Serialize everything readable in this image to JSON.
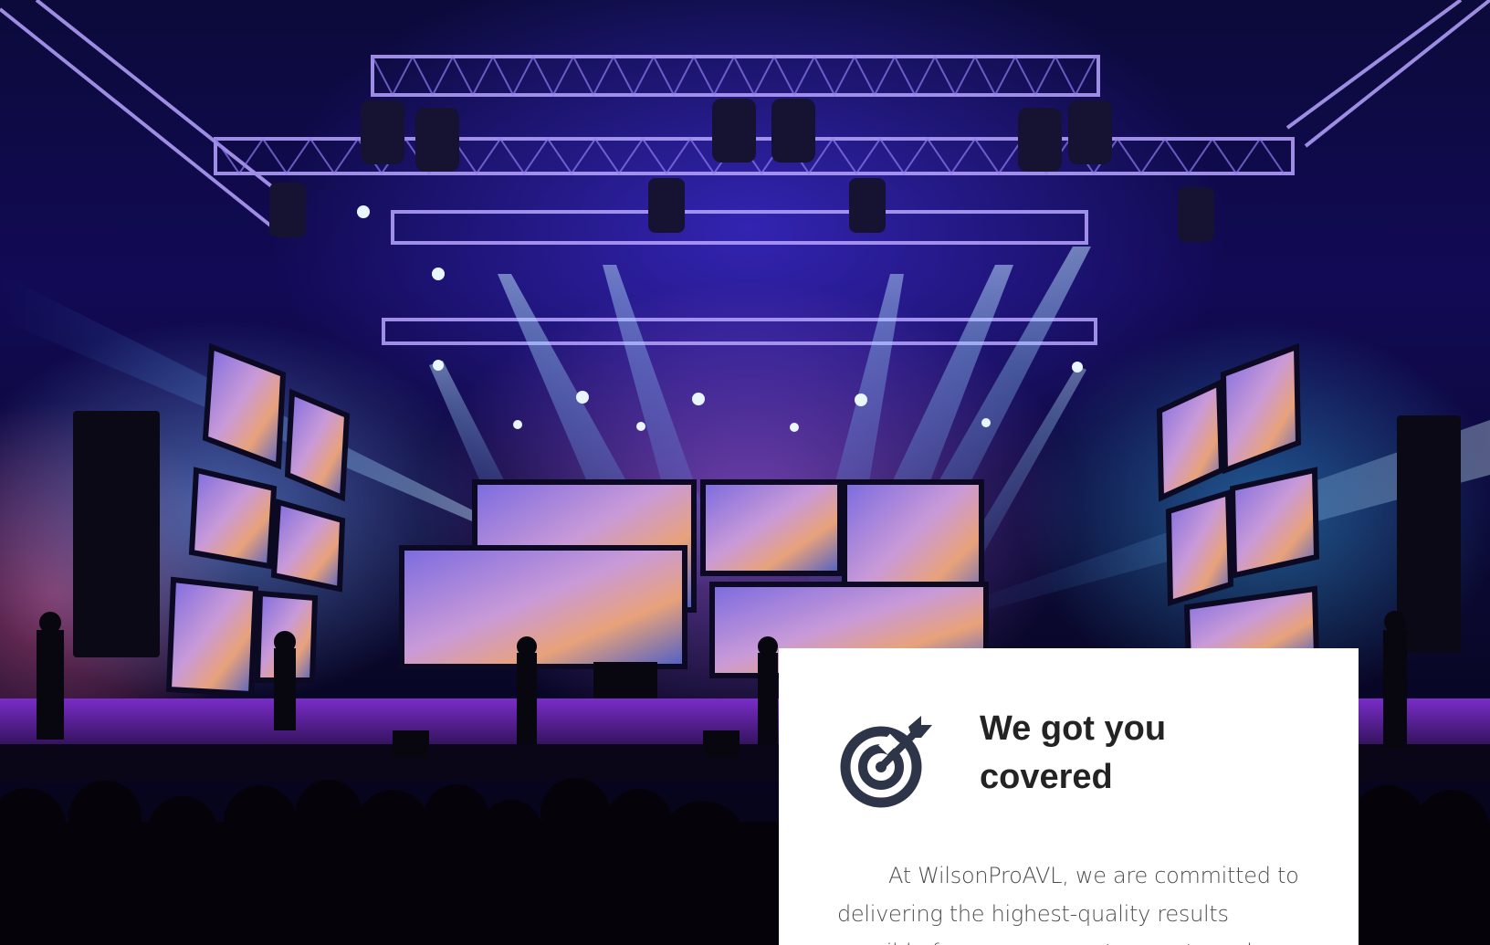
{
  "colors": {
    "card_background": "#ffffff",
    "heading_text": "#232323",
    "body_text": "#4d4d4d",
    "icon_fill": "#2e3548"
  },
  "hero": {
    "image_description_icon": "concert-stage-photo"
  },
  "feature_card": {
    "icon": "target-arrow-icon",
    "title": "We got you covered",
    "body": "At WilsonProAVL, we are committed to delivering the highest-quality results possible for your corporate events and"
  }
}
